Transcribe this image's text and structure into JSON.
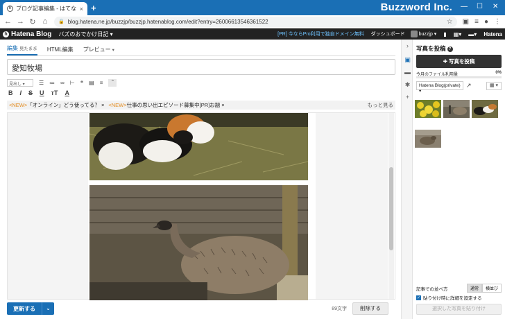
{
  "browser": {
    "tab_title": "ブログ記事編集 - はてなブログ",
    "tab_close": "×",
    "new_tab": "+",
    "brand_overlay": "Buzzword Inc.",
    "url": "blog.hatena.ne.jp/buzzjp/buzzjp.hatenablog.com/edit?entry=26006613546361522",
    "win_minimize": "—",
    "win_maximize": "☐",
    "win_close": "✕"
  },
  "hatena_nav": {
    "logo": "Hatena Blog",
    "blog_name": "バズのおでかけ日記 ▾",
    "promo": "[PR] 今ならPro利用で独自ドメイン無料",
    "dashboard": "ダッシュボード",
    "username": "buzzjp ▾",
    "right_logo": "Hatena"
  },
  "editor": {
    "tabs": [
      {
        "label": "編集",
        "sub": "見たまま"
      },
      {
        "label": "HTML編集",
        "sub": ""
      },
      {
        "label": "プレビュー",
        "sub": "▾"
      }
    ],
    "title": "愛知牧場",
    "heading_select": "見出し ▾",
    "related_themes": [
      {
        "tag": "<NEW>",
        "text": "「オンライン」どう使ってる？ ×"
      },
      {
        "tag": "<NEW>",
        "text": "仕事の思い出エピソード募集中[PR]お題 ×"
      }
    ],
    "more": "もっと見る",
    "update_button": "更新する",
    "char_count": "89文字",
    "delete_button": "削除する"
  },
  "photo_panel": {
    "title": "写真を投稿",
    "post_button": "✚ 写真を投稿",
    "usage_label": "今月のファイル利用量",
    "usage_value": "0%",
    "usage_fraction": 0,
    "album": "Hatena Blog(private) ▾",
    "order_label": "記事での並べ方",
    "order_options": [
      "通常",
      "横並び"
    ],
    "paste_detail_checkbox": "貼り付け時に詳細を設定する",
    "paste_button": "選択した写真を貼り付け"
  },
  "colors": {
    "accent": "#1a6fb5",
    "new_tag": "#e38a1c",
    "tabstrip": "#1a6fb5",
    "nav_bg": "#222222"
  }
}
